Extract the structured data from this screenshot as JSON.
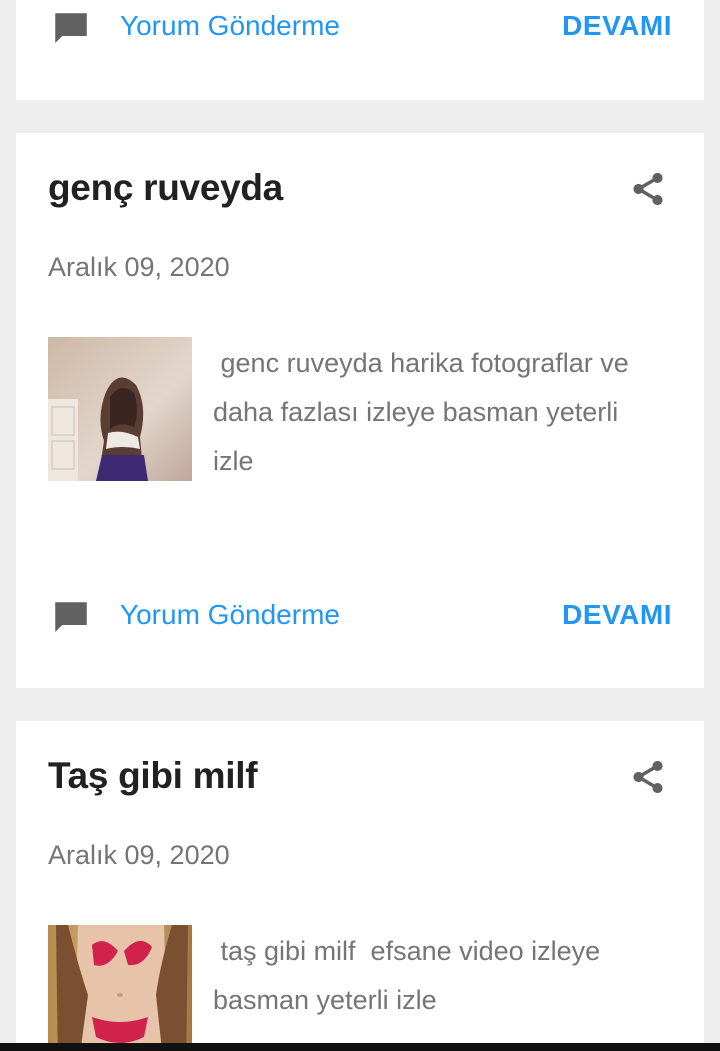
{
  "top_card": {
    "comment_label": "Yorum Gönderme",
    "more_label": "DEVAMI"
  },
  "posts": [
    {
      "title": "genç ruveyda",
      "date": "Aralık 09, 2020",
      "snippet": " genc ruveyda harika fotograflar ve daha fazlası izleye basman yeterli izle",
      "comment_label": "Yorum Gönderme",
      "more_label": "DEVAMI",
      "thumbnail_icon": "photo-thumbnail"
    },
    {
      "title": "Taş gibi milf",
      "date": "Aralık 09, 2020",
      "snippet": " taş gibi milf  efsane video izleye basman yeterli izle",
      "thumbnail_icon": "photo-thumbnail"
    }
  ],
  "icons": {
    "comment": "comment-icon",
    "share": "share-icon"
  },
  "colors": {
    "background": "#eeeeee",
    "card": "#ffffff",
    "title": "#212121",
    "meta_text": "#757575",
    "link": "#2196f3",
    "icon": "#616161"
  }
}
